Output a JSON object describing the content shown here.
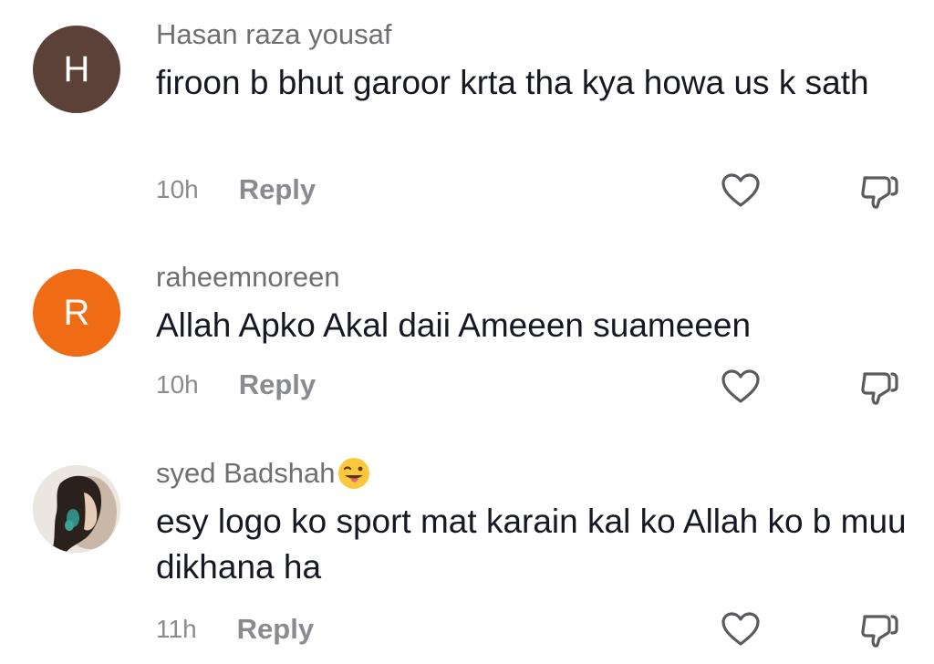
{
  "comments": [
    {
      "initial": "H",
      "avatar_color": "#5b4137",
      "username": "Hasan raza yousaf",
      "text": "firoon b bhut garoor krta tha kya howa us k sath",
      "time": "10h",
      "reply_label": "Reply"
    },
    {
      "initial": "R",
      "avatar_color": "#ef6b14",
      "username": "raheemnoreen",
      "text": "Allah Apko Akal daii Ameeen suameeen",
      "time": "10h",
      "reply_label": "Reply"
    },
    {
      "username": "syed Badshah",
      "username_emoji": "winking-face-with-tongue",
      "avatar_type": "photo",
      "text": "esy logo ko sport mat karain kal ko Allah ko b muu dikhana ha",
      "time": "11h",
      "reply_label": "Reply"
    }
  ],
  "icons": {
    "like": "heart-outline-icon",
    "dislike": "thumbs-down-outline-icon"
  }
}
